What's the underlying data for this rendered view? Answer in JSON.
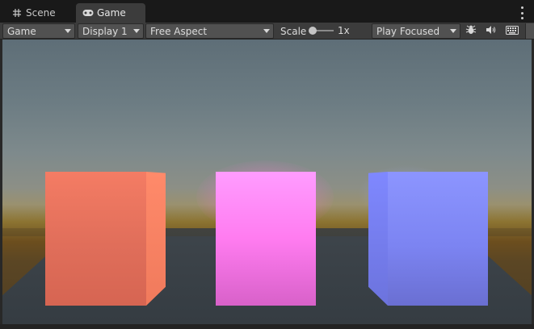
{
  "tabs": [
    {
      "label": "Scene",
      "icon": "grid-icon",
      "active": false
    },
    {
      "label": "Game",
      "icon": "gamepad-icon",
      "active": true
    }
  ],
  "toolbar": {
    "view_dropdown": "Game",
    "display_dropdown": "Display 1",
    "aspect_dropdown": "Free Aspect",
    "scale_label": "Scale",
    "scale_value": "1x",
    "play_mode_dropdown": "Play Focused"
  },
  "icons": {
    "stats": "bug-icon",
    "audio": "speaker-icon",
    "keyboard": "keyboard-icon",
    "menu": "kebab-menu-icon"
  },
  "colors": {
    "panel": "#3c3c3c",
    "dropdown": "#515151",
    "red_cube": "#f47c64",
    "pink_cube": "#ff7cf0",
    "blue_cube": "#7c84f2"
  }
}
